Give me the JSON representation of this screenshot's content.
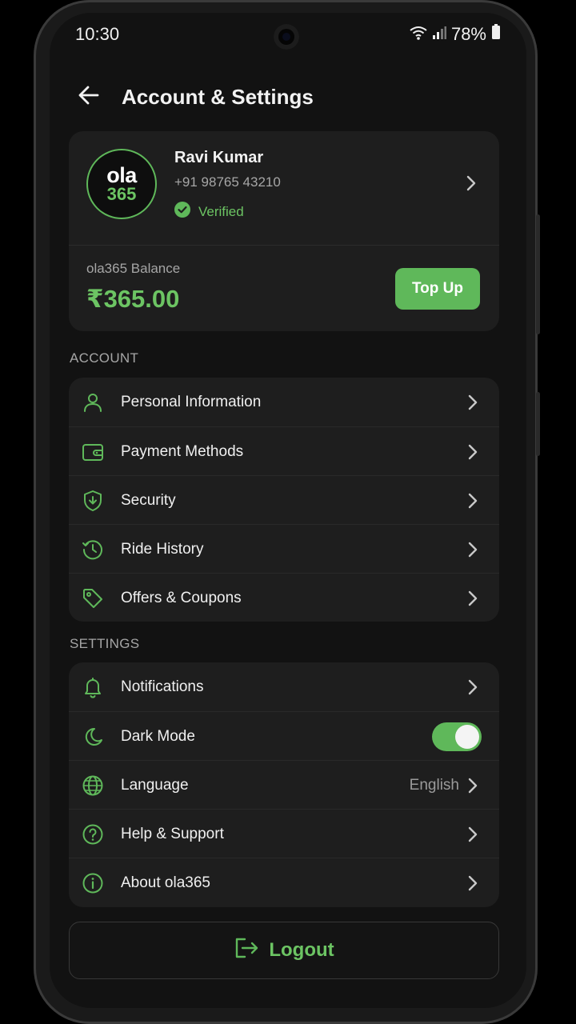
{
  "status_bar": {
    "time": "10:30",
    "battery": "78%"
  },
  "header": {
    "title": "Account & Settings"
  },
  "profile": {
    "avatar_line1": "ola",
    "avatar_line2": "365",
    "name": "Ravi Kumar",
    "phone": "+91 98765 43210",
    "verified_label": "Verified",
    "balance_label": "ola365 Balance",
    "balance_value": "₹365.00",
    "topup_label": "Top Up"
  },
  "account": {
    "section_label": "ACCOUNT",
    "items": [
      {
        "label": "Personal Information",
        "icon": "user-icon"
      },
      {
        "label": "Payment Methods",
        "icon": "wallet-icon"
      },
      {
        "label": "Security",
        "icon": "shield-icon"
      },
      {
        "label": "Ride History",
        "icon": "clock-icon"
      },
      {
        "label": "Offers & Coupons",
        "icon": "tag-icon"
      }
    ]
  },
  "settings": {
    "section_label": "SETTINGS",
    "items": [
      {
        "label": "Notifications",
        "icon": "bell-icon"
      },
      {
        "label": "Dark Mode",
        "icon": "moon-icon",
        "toggle_on": true
      },
      {
        "label": "Language",
        "icon": "globe-icon",
        "value": "English"
      },
      {
        "label": "Help & Support",
        "icon": "help-circle-icon"
      },
      {
        "label": "About ola365",
        "icon": "info-icon"
      }
    ]
  },
  "logout": {
    "label": "Logout"
  },
  "colors": {
    "accent": "#5fb85a",
    "accent_text": "#6cc463",
    "background": "#121212",
    "card": "#1e1e1e"
  }
}
